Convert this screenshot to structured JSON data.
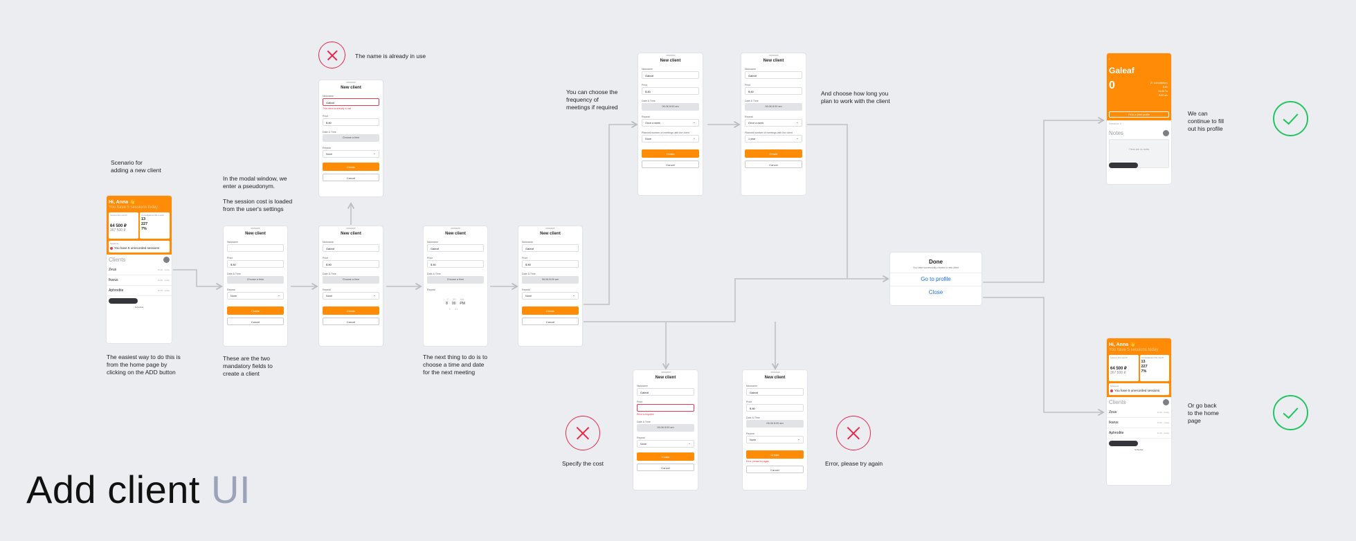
{
  "title": {
    "main": "Add client",
    "accent": "UI"
  },
  "notes": {
    "scenario": "Scenario for\nadding a new client",
    "easiest": "The easiest way to do this is\nfrom the home page by\nclicking on the ADD button",
    "modal": "In the modal window, we\nenter a pseudonym.\n\nThe session cost is loaded\nfrom the user's settings",
    "mandatory": "These are the two\nmandatory fields to\ncreate a client",
    "name_in_use": "The name is already in use",
    "next_thing": "The next thing to do is to\nchoose a time and date\nfor the next meeting",
    "frequency": "You can choose the\nfrequency of\nmeetings if required",
    "how_long": "And choose how long you\nplan to work with the client",
    "specify_cost": "Specify the cost",
    "error_try": "Error, please try again",
    "continue_profile": "We can\ncontinue to fill\nout his profile",
    "go_back": "Or go back\nto the home\npage"
  },
  "form": {
    "title": "New client",
    "nickname_label": "Nickname",
    "price_label": "Price",
    "price_value": "$ 80",
    "price_value_short": "$ 80",
    "datetime_label": "Date & Time",
    "datetime_placeholder": "Choose a time",
    "datetime_value": "06.06 8:00 am",
    "repeat_label": "Repeat",
    "repeat_none": "None",
    "repeat_weekly": "Once a week",
    "plan_label": "Planned number of meetings with the client",
    "plan_value_none": "None",
    "plan_value_year": "1 year",
    "create": "Create",
    "cancel": "Cancel",
    "name_value": "Galeaf",
    "name_error": "This name is already in use",
    "price_error": "Price is required",
    "create_error": "Error, please try again"
  },
  "time_picker": {
    "hours": [
      "7",
      "8",
      "9"
    ],
    "minutes": [
      "59",
      "00",
      "01"
    ],
    "ampm": [
      "AM",
      "PM"
    ]
  },
  "home": {
    "greeting": "Hi, Anna 👋",
    "subtitle": "You have 5 sessions today",
    "card1_label": "Income this month",
    "card1_value": "64 500 ₽",
    "card1_sub": "367 500 ₽",
    "card2_label": "Consultations this month",
    "card2_value1": "13",
    "card2_value2": "227",
    "card2_value3": "7%",
    "sessions_label": "Sessions",
    "sessions_text": "You have 5 unrecorded sessions",
    "clients_title": "Clients",
    "clients": [
      "Zeus",
      "Ikarus",
      "Aphrodite"
    ],
    "clients_time": "11:00 · today",
    "nav_label": "Schedule"
  },
  "profile": {
    "name": "Galeaf",
    "zero": "0",
    "side_text": "21 consultations\n$ 80\n06.06 Tu\n8:00 am",
    "button": "Fill in a client profile",
    "sessions_caption": "Sessions: 0",
    "notes_title": "Notes",
    "notes_placeholder": "There are no notes"
  },
  "done": {
    "title": "Done",
    "subtitle": "You have successfully created a new client",
    "go_profile": "Go to profile",
    "close": "Close"
  },
  "colors": {
    "accent": "#ff8b07",
    "error": "#e8264a",
    "success": "#22c462",
    "link": "#1f6fe6",
    "background": "#ecedf1",
    "title_accent": "#9aa3b8"
  }
}
